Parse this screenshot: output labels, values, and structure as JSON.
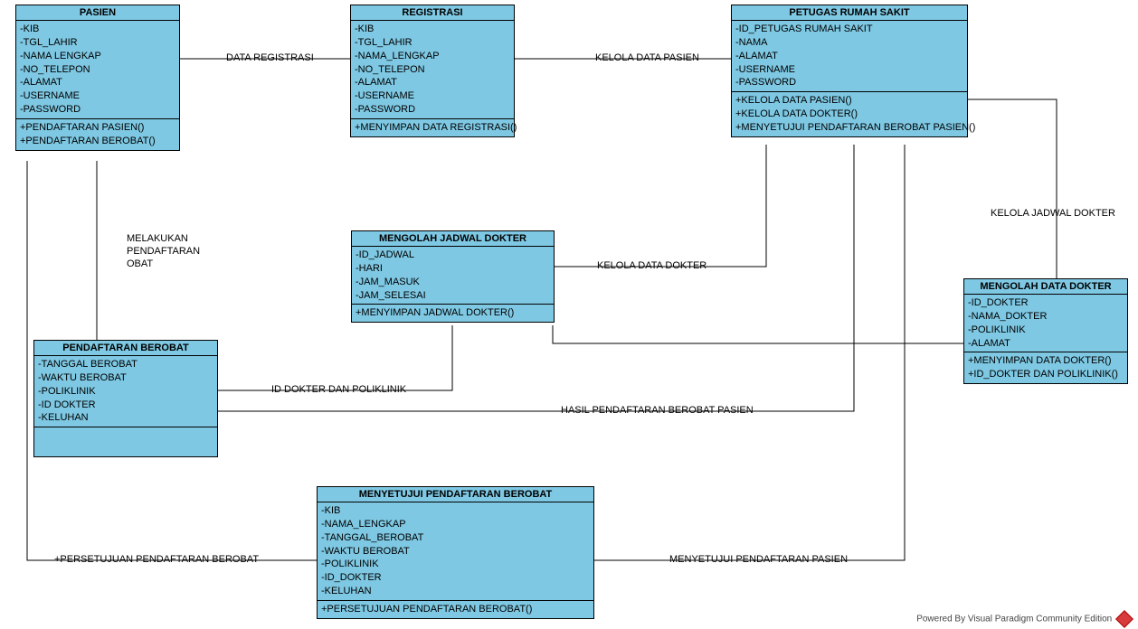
{
  "classes": {
    "pasien": {
      "title": "PASIEN",
      "attrs": [
        "-KIB",
        "-TGL_LAHIR",
        "-NAMA LENGKAP",
        "-NO_TELEPON",
        "-ALAMAT",
        "-USERNAME",
        "-PASSWORD"
      ],
      "methods": [
        "+PENDAFTARAN PASIEN()",
        "+PENDAFTARAN BEROBAT()"
      ]
    },
    "registrasi": {
      "title": "REGISTRASI",
      "attrs": [
        "-KIB",
        "-TGL_LAHIR",
        "-NAMA_LENGKAP",
        "-NO_TELEPON",
        "-ALAMAT",
        "-USERNAME",
        "-PASSWORD"
      ],
      "methods": [
        "+MENYIMPAN DATA REGISTRASI()"
      ]
    },
    "petugas": {
      "title": "PETUGAS RUMAH SAKIT",
      "attrs": [
        "-ID_PETUGAS RUMAH SAKIT",
        "-NAMA",
        "-ALAMAT",
        "-USERNAME",
        "-PASSWORD"
      ],
      "methods": [
        "+KELOLA DATA PASIEN()",
        "+KELOLA DATA DOKTER()",
        "+MENYETUJUI PENDAFTARAN BEROBAT PASIEN()"
      ]
    },
    "jadwal": {
      "title": "MENGOLAH JADWAL DOKTER",
      "attrs": [
        "-ID_JADWAL",
        "-HARI",
        "-JAM_MASUK",
        "-JAM_SELESAI"
      ],
      "methods": [
        "+MENYIMPAN JADWAL DOKTER()"
      ]
    },
    "pendaftaran": {
      "title": "PENDAFTARAN BEROBAT",
      "attrs": [
        "-TANGGAL BEROBAT",
        "-WAKTU BEROBAT",
        "-POLIKLINIK",
        "-ID DOKTER",
        "-KELUHAN"
      ],
      "methods": []
    },
    "mengolahDokter": {
      "title": "MENGOLAH DATA DOKTER",
      "attrs": [
        "-ID_DOKTER",
        "-NAMA_DOKTER",
        "-POLIKLINIK",
        "-ALAMAT"
      ],
      "methods": [
        "+MENYIMPAN DATA DOKTER()",
        "+ID_DOKTER DAN POLIKLINIK()"
      ]
    },
    "menyetujui": {
      "title": "MENYETUJUI PENDAFTARAN BEROBAT",
      "attrs": [
        "-KIB",
        "-NAMA_LENGKAP",
        "-TANGGAL_BEROBAT",
        "-WAKTU BEROBAT",
        "-POLIKLINIK",
        "-ID_DOKTER",
        "-KELUHAN"
      ],
      "methods": [
        "+PERSETUJUAN PENDAFTARAN BEROBAT()"
      ]
    }
  },
  "labels": {
    "dataRegistrasi": "DATA REGISTRASI",
    "kelolaDataPasien": "KELOLA DATA PASIEN",
    "kelolaJadwalDokter": "KELOLA JADWAL DOKTER",
    "melakukanPendaftaranObat_l1": "MELAKUKAN",
    "melakukanPendaftaranObat_l2": "PENDAFTARAN",
    "melakukanPendaftaranObat_l3": "OBAT",
    "kelolaDataDokter": "KELOLA DATA DOKTER",
    "idDokterPoliklinik": "ID DOKTER DAN POLIKLINIK",
    "hasilPendaftaran": "HASIL PENDAFTARAN BEROBAT PASIEN",
    "persetujuanPendaftaran": "+PERSETUJUAN PENDAFTARAN BEROBAT",
    "menyetujuiPendaftaranPasien": "MENYETUJUI PENDAFTARAN PASIEN"
  },
  "footer": "Powered By  Visual Paradigm Community Edition"
}
